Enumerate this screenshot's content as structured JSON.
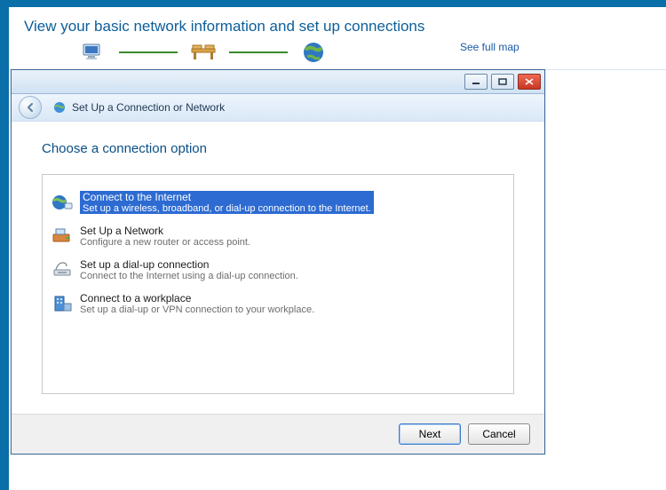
{
  "background": {
    "heading": "View your basic network information and set up connections",
    "see_full_map": "See full map"
  },
  "wizard": {
    "window_title": "Set Up a Connection or Network",
    "instruction": "Choose a connection option",
    "options": [
      {
        "title": "Connect to the Internet",
        "desc": "Set up a wireless, broadband, or dial-up connection to the Internet.",
        "selected": true
      },
      {
        "title": "Set Up a Network",
        "desc": "Configure a new router or access point.",
        "selected": false
      },
      {
        "title": "Set up a dial-up connection",
        "desc": "Connect to the Internet using a dial-up connection.",
        "selected": false
      },
      {
        "title": "Connect to a workplace",
        "desc": "Set up a dial-up or VPN connection to your workplace.",
        "selected": false
      }
    ],
    "buttons": {
      "next": "Next",
      "cancel": "Cancel"
    }
  }
}
